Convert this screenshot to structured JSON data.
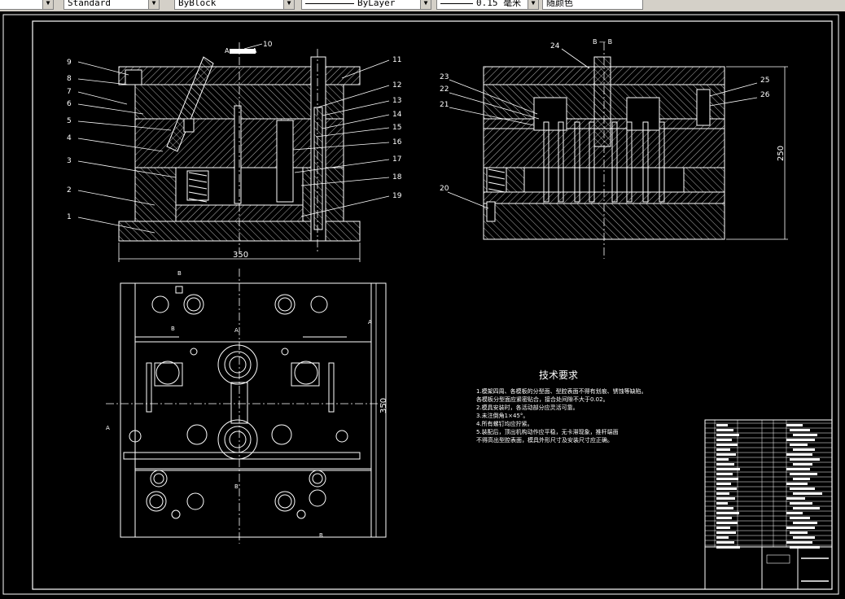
{
  "toolbar": {
    "style_value": "Standard",
    "layer_value": "ByBlock",
    "linetype_value": "ByLayer",
    "lineweight_value": "0.15 毫米",
    "color_value": "随颜色"
  },
  "drawing": {
    "part_labels": [
      "1",
      "2",
      "3",
      "4",
      "5",
      "6",
      "7",
      "8",
      "9",
      "10",
      "11",
      "12",
      "13",
      "14",
      "15",
      "16",
      "17",
      "18",
      "19",
      "20",
      "21",
      "22",
      "23",
      "24",
      "25",
      "26"
    ],
    "dim_width_main": "350",
    "dim_height_plan": "350",
    "dim_height_side": "250",
    "section_label_side": "B — B",
    "section_letter_a": "A",
    "section_letter_b": "B",
    "tech_title": "技术要求",
    "tech_notes": [
      "1.模架四周、各模板的分型面、型腔表面不得有划痕、锈蚀等缺陷。",
      "  各模板分型面应紧密贴合，接合处间隙不大于0.02。",
      "2.模具安装时，各活动部分应灵活可靠。",
      "3.未注倒角1×45°。",
      "4.所有螺钉均应拧紧。",
      "5.装配后，顶出机构动作应平稳，无卡滞现象，推杆端面",
      "  不得高出型腔表面，模具外形尺寸及安装尺寸应正确。"
    ]
  },
  "colors": {
    "background": "#000000",
    "line": "#ffffff",
    "accent": "#ffff00"
  }
}
